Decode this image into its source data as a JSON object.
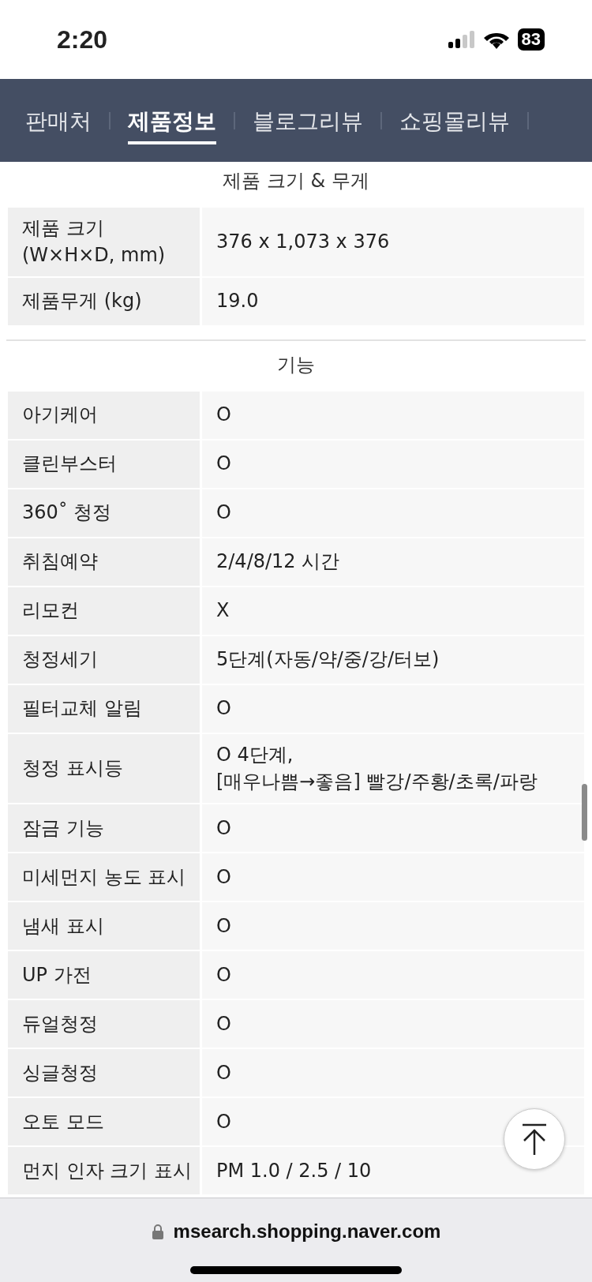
{
  "status_bar": {
    "time": "2:20",
    "battery": "83"
  },
  "tabs": [
    {
      "label": "판매처",
      "selected": false
    },
    {
      "label": "제품정보",
      "selected": true
    },
    {
      "label": "블로그리뷰",
      "selected": false
    },
    {
      "label": "쇼핑몰리뷰",
      "selected": false
    }
  ],
  "sections": [
    {
      "title": "제품 크기 & 무게",
      "rows": [
        {
          "label": "제품 크기\n(W×H×D, mm)",
          "value": "376 x 1,073 x 376"
        },
        {
          "label": "제품무게 (kg)",
          "value": "19.0"
        }
      ]
    },
    {
      "title": "기능",
      "rows": [
        {
          "label": "아기케어",
          "value": "O"
        },
        {
          "label": "클린부스터",
          "value": "O"
        },
        {
          "label": "360˚ 청정",
          "value": "O"
        },
        {
          "label": "취침예약",
          "value": "2/4/8/12 시간"
        },
        {
          "label": "리모컨",
          "value": "X"
        },
        {
          "label": "청정세기",
          "value": "5단계(자동/약/중/강/터보)"
        },
        {
          "label": "필터교체 알림",
          "value": "O"
        },
        {
          "label": "청정 표시등",
          "value": "O 4단계,\n[매우나쁨→좋음] 빨강/주황/초록/파랑"
        },
        {
          "label": "잠금 기능",
          "value": "O"
        },
        {
          "label": "미세먼지 농도 표시",
          "value": "O"
        },
        {
          "label": "냄새 표시",
          "value": "O"
        },
        {
          "label": "UP 가전",
          "value": "O"
        },
        {
          "label": "듀얼청정",
          "value": "O"
        },
        {
          "label": "싱글청정",
          "value": "O"
        },
        {
          "label": "오토 모드",
          "value": "O"
        },
        {
          "label": "먼지 인자 크기 표시",
          "value": "PM 1.0 / 2.5 / 10"
        }
      ]
    }
  ],
  "address_bar": {
    "url": "msearch.shopping.naver.com"
  }
}
